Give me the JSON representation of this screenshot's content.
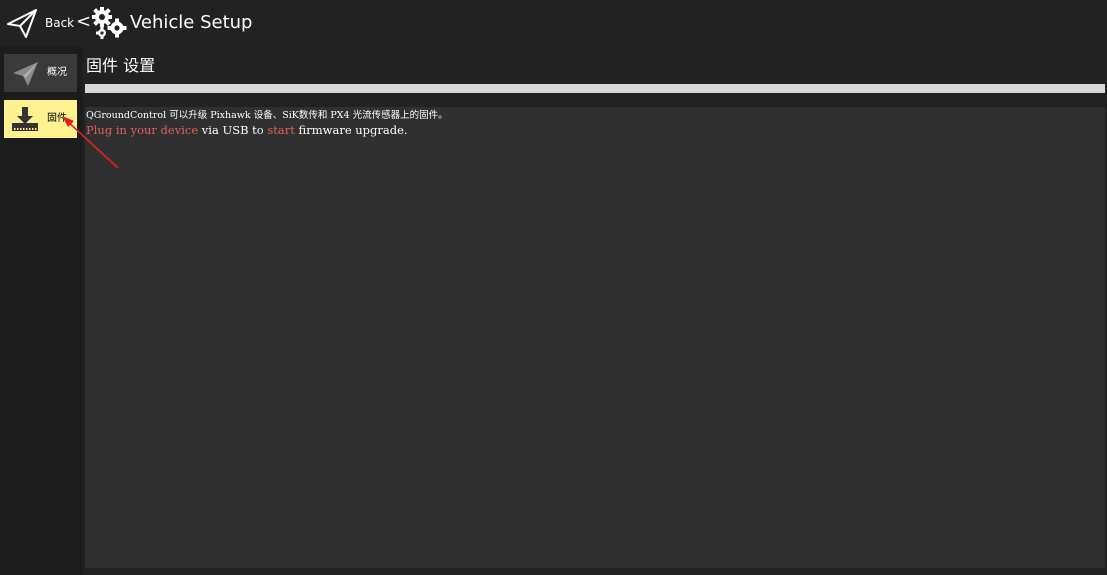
{
  "header": {
    "back_label": "Back",
    "chevron": "<",
    "title": "Vehicle Setup",
    "back_icon": "paper-plane-icon",
    "title_icon": "gears-icon"
  },
  "sidebar": {
    "items": [
      {
        "label": "概况",
        "icon": "paper-plane-icon",
        "selected": false
      },
      {
        "label": "固件",
        "icon": "download-icon",
        "selected": true
      }
    ]
  },
  "main": {
    "heading": "固件 设置",
    "progress": 0,
    "log": {
      "line1": "QGroundControl 可以升级 Pixhawk 设备、SiK数传和 PX4 光流传感器上的固件。",
      "line2_part1": "Plug in your device",
      "line2_part2": " via USB to ",
      "line2_part3": "start",
      "line2_part4": " firmware upgrade."
    }
  },
  "colors": {
    "background": "#222222",
    "sidebar_selected": "#fff291",
    "log_panel": "#303030",
    "warning_text": "#e06060",
    "annotation_arrow": "#e02020"
  }
}
